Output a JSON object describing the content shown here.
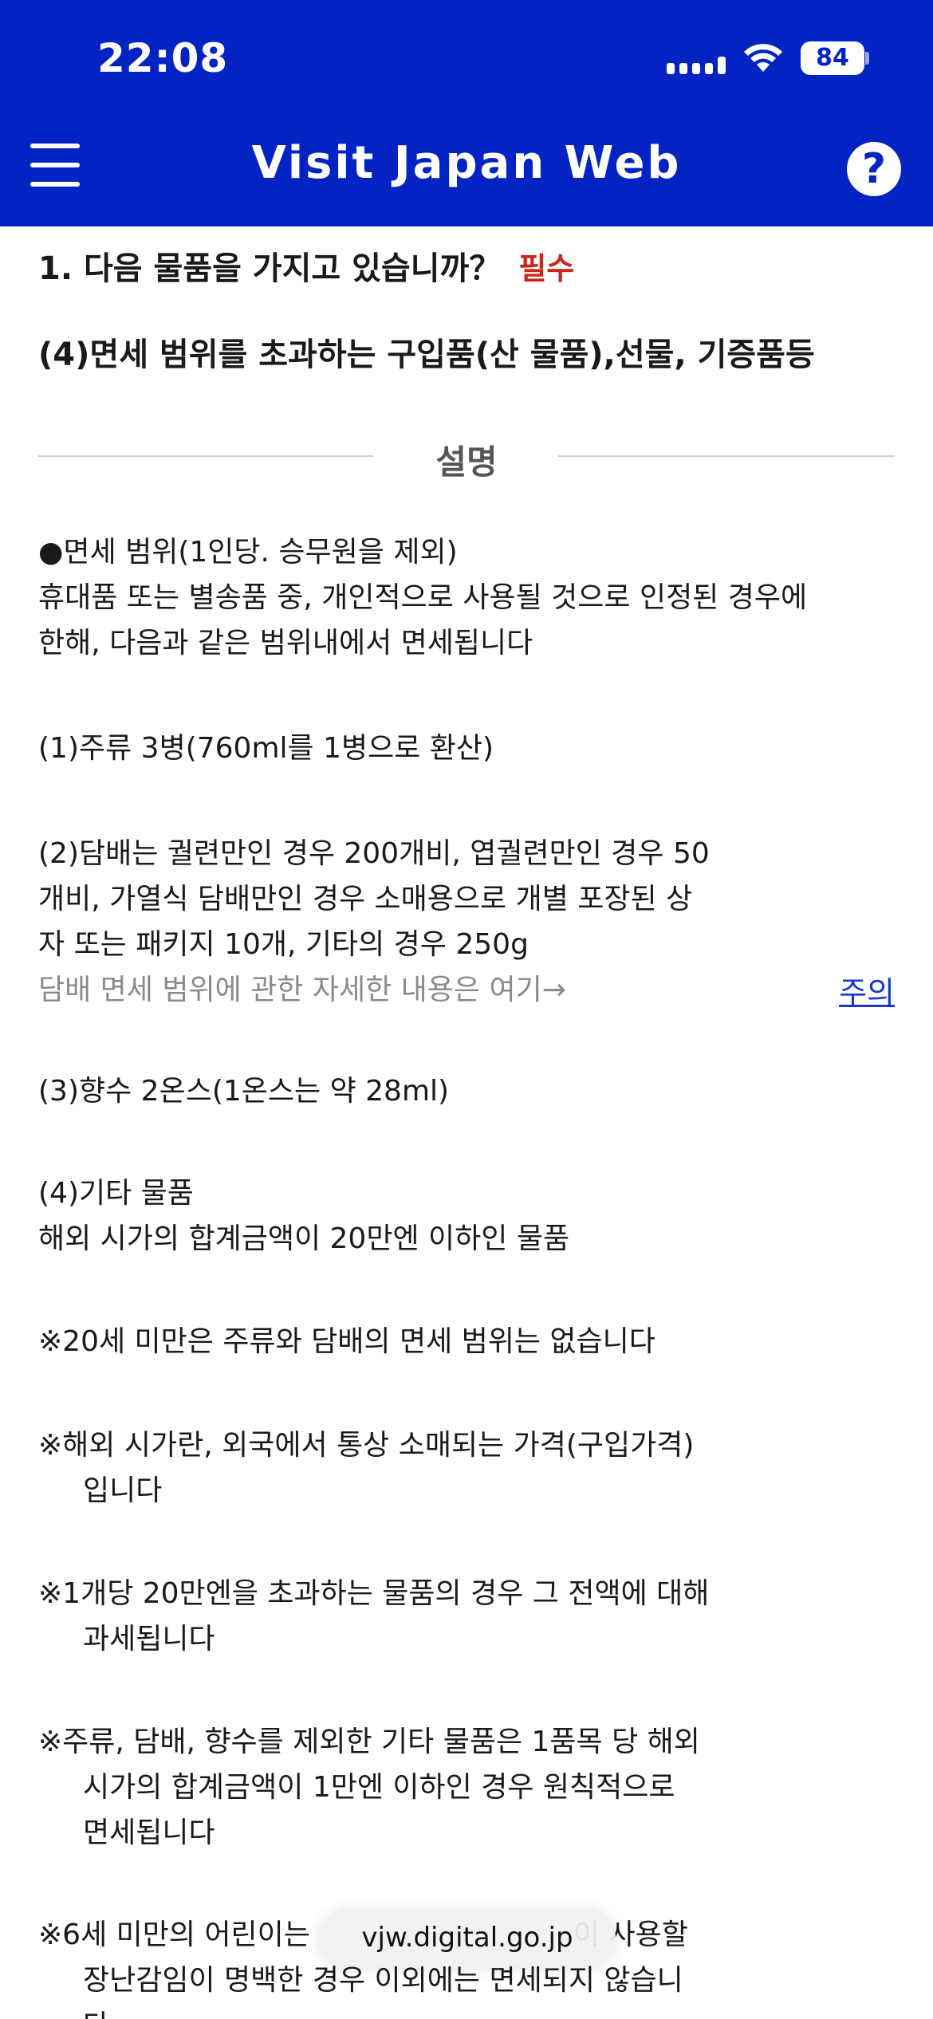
{
  "status_bar": {
    "time": "22:08",
    "battery": "84"
  },
  "header": {
    "title": "Visit Japan Web"
  },
  "question": {
    "text": "1. 다음 물품을 가지고 있습니까？",
    "required": "필수"
  },
  "sub_question": "(4)면세 범위를 초과하는 구입품(산 물품),선물, 기증품등",
  "section_title": "설명",
  "paragraphs": {
    "p1": {
      "l1": "●면세 범위(1인당. 승무원을 제외)",
      "l2": "휴대품 또는 별송품 중, 개인적으로 사용될 것으로 인정된 경우에",
      "l3": "한해, 다음과 같은 범위내에서 면세됩니다"
    },
    "p2": {
      "l1": "(1)주류 3병(760ml를 1병으로 환산)"
    },
    "p3": {
      "l1": "(2)담배는 궐련만인 경우 200개비, 엽궐련만인 경우 50",
      "l2": "개비, 가열식 담배만인 경우 소매용으로 개별 포장된 상",
      "l3": "자 또는 패키지 10개, 기타의 경우 250g",
      "l4": "담배 면세 범위에 관한 자세한 내용은 여기→",
      "link": "주의"
    },
    "p4": {
      "l1": "(3)향수 2온스(1온스는 약 28ml)"
    },
    "p5": {
      "l1": "(4)기타 물품",
      "l2": "해외 시가의 합계금액이 20만엔 이하인 물품"
    },
    "p6": {
      "l1": "※20세 미만은 주류와 담배의 면세 범위는 없습니다"
    },
    "p7": {
      "l1": "※해외 시가란, 외국에서 통상 소매되는 가격(구입가격)",
      "l2": "입니다"
    },
    "p8": {
      "l1": "※1개당 20만엔을 초과하는 물품의 경우 그 전액에 대해",
      "l2": "과세됩니다"
    },
    "p9": {
      "l1": "※주류, 담배, 향수를 제외한 기타 물품은 1품목 당 해외",
      "l2": "시가의 합계금액이 1만엔 이하인 경우 원칙적으로",
      "l3": "면세됩니다"
    },
    "p10": {
      "l1": "※6세 미만의 어린이는",
      "l1b": "이 사용할",
      "l2": "장난감임이 명백한 경우 이외에는 면세되지 않습니",
      "l3": "다"
    }
  },
  "url_bar": {
    "text": "vjw.digital.go.jp"
  }
}
